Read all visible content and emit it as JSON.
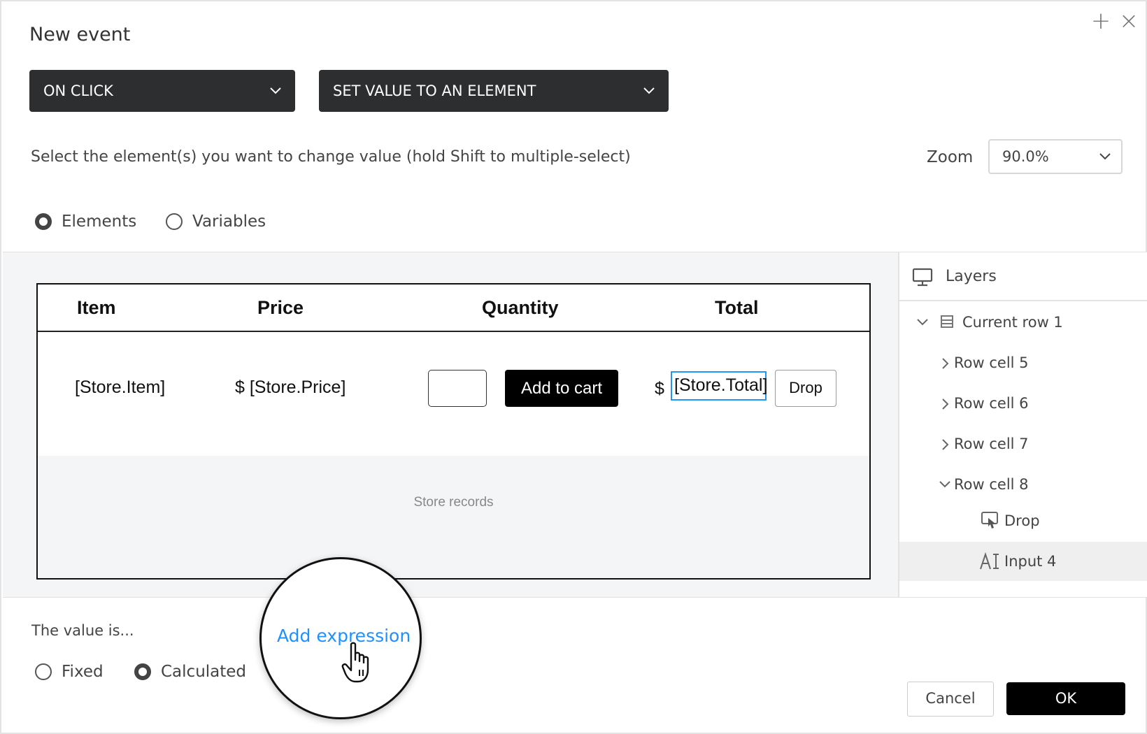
{
  "dialog": {
    "title": "New event",
    "add_glyph": "+",
    "close_glyph": "×"
  },
  "trigger": {
    "value": "ON CLICK"
  },
  "action": {
    "value": "SET VALUE TO AN ELEMENT"
  },
  "instruction": "Select the element(s) you want to change value (hold Shift to multiple-select)",
  "zoom": {
    "label": "Zoom",
    "value": "90.0%"
  },
  "target_type": {
    "options": [
      {
        "label": "Elements",
        "checked": true
      },
      {
        "label": "Variables",
        "checked": false
      }
    ]
  },
  "table": {
    "headers": [
      "Item",
      "Price",
      "Quantity",
      "Total"
    ],
    "row": {
      "item": "[Store.Item]",
      "price_symbol": "$",
      "price": "[Store.Price]",
      "add_button": "Add to cart",
      "total_symbol": "$",
      "total": "[Store.Total]",
      "drop_button": "Drop"
    },
    "records_label": "Store records"
  },
  "layers": {
    "title": "Layers",
    "items": [
      {
        "label": "Current row 1",
        "icon": "row-icon",
        "expanded": true
      },
      {
        "label": "Row cell 5",
        "expanded": false
      },
      {
        "label": "Row cell 6",
        "expanded": false
      },
      {
        "label": "Row cell 7",
        "expanded": false
      },
      {
        "label": "Row cell 8",
        "expanded": true
      },
      {
        "label": "Drop",
        "icon": "button-icon"
      },
      {
        "label": "Input 4",
        "icon": "text-input-icon",
        "selected": true
      }
    ]
  },
  "value": {
    "label": "The value is...",
    "options": [
      {
        "label": "Fixed",
        "checked": false
      },
      {
        "label": "Calculated",
        "checked": true
      }
    ],
    "add_expression": "Add expression"
  },
  "footer": {
    "cancel": "Cancel",
    "ok": "OK"
  },
  "colors": {
    "accent": "#1e90ff",
    "dark": "#2d2e30",
    "selection": "#2196f3"
  }
}
